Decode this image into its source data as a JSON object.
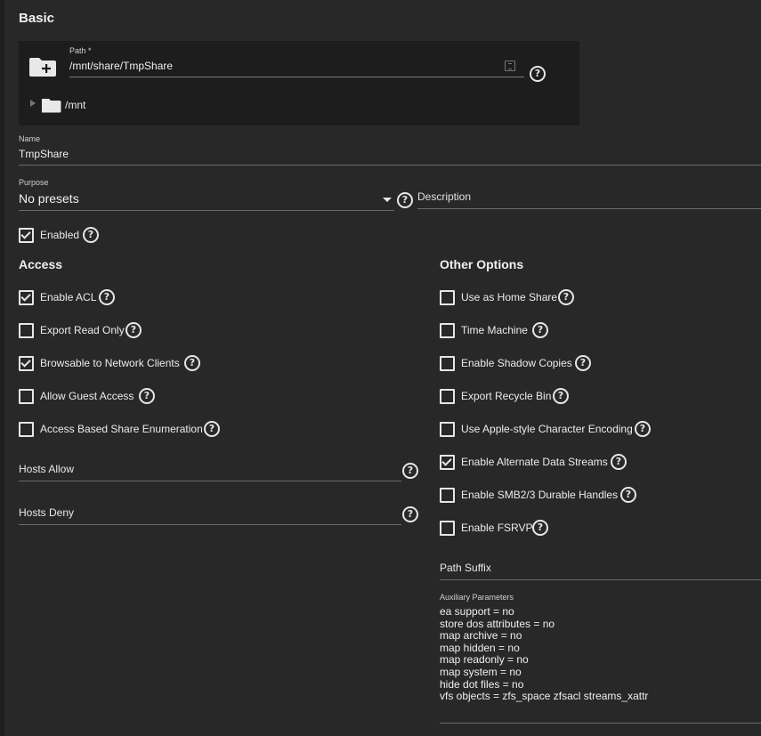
{
  "basic": {
    "title": "Basic"
  },
  "path": {
    "label": "Path *",
    "value": "/mnt/share/TmpShare",
    "tree_root": "/mnt"
  },
  "name": {
    "label": "Name",
    "value": "TmpShare"
  },
  "purpose": {
    "label": "Purpose",
    "value": "No presets"
  },
  "description": {
    "placeholder": "Description"
  },
  "enabled": {
    "label": "Enabled",
    "checked": true
  },
  "access": {
    "title": "Access",
    "items": [
      {
        "label": "Enable ACL",
        "checked": true
      },
      {
        "label": "Export Read Only",
        "checked": false
      },
      {
        "label": "Browsable to Network Clients",
        "checked": true
      },
      {
        "label": "Allow Guest Access",
        "checked": false
      },
      {
        "label": "Access Based Share Enumeration",
        "checked": false
      }
    ],
    "hosts_allow": "Hosts Allow",
    "hosts_deny": "Hosts Deny"
  },
  "other": {
    "title": "Other Options",
    "items": [
      {
        "label": "Use as Home Share",
        "checked": false
      },
      {
        "label": "Time Machine",
        "checked": false
      },
      {
        "label": "Enable Shadow Copies",
        "checked": false
      },
      {
        "label": "Export Recycle Bin",
        "checked": false
      },
      {
        "label": "Use Apple-style Character Encoding",
        "checked": false
      },
      {
        "label": "Enable Alternate Data Streams",
        "checked": true
      },
      {
        "label": "Enable SMB2/3 Durable Handles",
        "checked": false
      },
      {
        "label": "Enable FSRVP",
        "checked": false
      }
    ],
    "path_suffix": "Path Suffix",
    "aux_label": "Auxiliary Parameters",
    "aux_lines": [
      "ea support = no",
      "store dos attributes = no",
      "map archive = no",
      "map hidden = no",
      "map readonly = no",
      "map system = no",
      "hide dot files = no",
      "vfs objects = zfs_space zfsacl streams_xattr"
    ]
  },
  "icons": {
    "help": "help-circle-icon",
    "folder_add": "create-new-folder-icon",
    "folder": "folder-icon",
    "expand": "chevron-right-icon",
    "dropdown": "caret-down-icon"
  },
  "colors": {
    "background": "#282828",
    "text": "#f0f0f0",
    "underline": "#6a6a6a"
  }
}
